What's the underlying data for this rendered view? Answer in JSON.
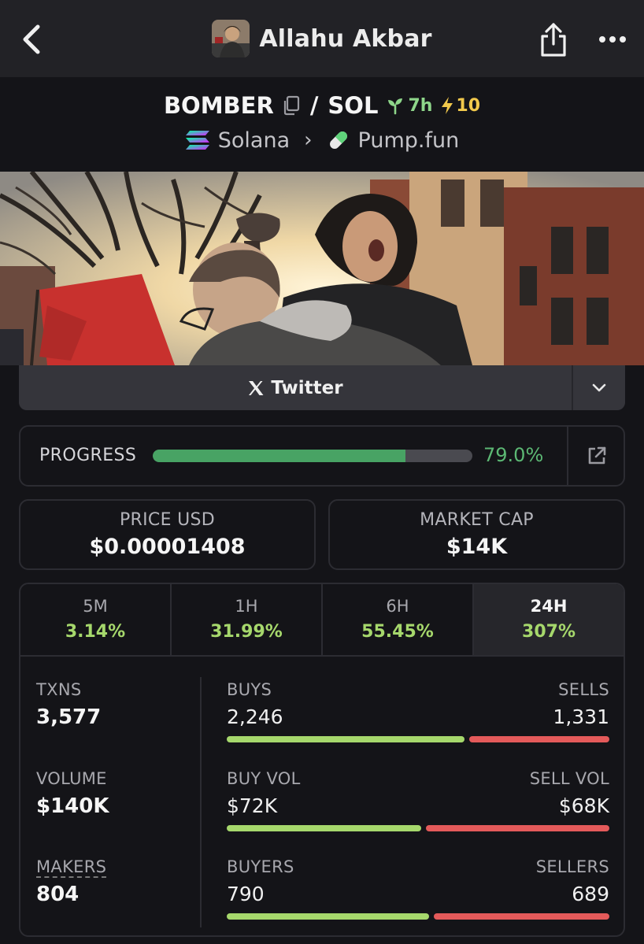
{
  "header": {
    "title": "Allahu Akbar"
  },
  "pair": {
    "base": "BOMBER",
    "separator": "/",
    "quote": "SOL",
    "age": "7h",
    "boosts": "10",
    "chain": "Solana",
    "dex": "Pump.fun"
  },
  "socials": {
    "twitter_label": "Twitter"
  },
  "progress": {
    "label": "PROGRESS",
    "value_text": "79.0%",
    "fraction": 0.79
  },
  "price": {
    "label": "PRICE USD",
    "value": "$0.00001408"
  },
  "market_cap": {
    "label": "MARKET CAP",
    "value": "$14K"
  },
  "timeframes": [
    {
      "label": "5M",
      "change": "3.14%"
    },
    {
      "label": "1H",
      "change": "31.99%"
    },
    {
      "label": "6H",
      "change": "55.45%"
    },
    {
      "label": "24H",
      "change": "307%",
      "active": true
    }
  ],
  "stats": {
    "txns": {
      "label": "TXNS",
      "value": "3,577"
    },
    "volume": {
      "label": "VOLUME",
      "value": "$140K"
    },
    "makers": {
      "label": "MAKERS",
      "value": "804"
    },
    "buys_sells": {
      "left_label": "BUYS",
      "right_label": "SELLS",
      "left_value": "2,246",
      "right_value": "1,331",
      "buy_share": 0.628
    },
    "buy_sell_vol": {
      "left_label": "BUY VOL",
      "right_label": "SELL VOL",
      "left_value": "$72K",
      "right_value": "$68K",
      "buy_share": 0.514
    },
    "buyers_sellers": {
      "left_label": "BUYERS",
      "right_label": "SELLERS",
      "left_value": "790",
      "right_value": "689",
      "buy_share": 0.534
    }
  },
  "colors": {
    "positive": "#a6d86c",
    "buy_bar": "#a6d86c",
    "sell_bar": "#e45a5a",
    "progress": "#48a364"
  },
  "icons": {
    "back": "chevron-left-icon",
    "share": "share-icon",
    "more": "more-horizontal-icon",
    "copy": "copy-icon",
    "age": "sprout-icon",
    "boost": "lightning-icon",
    "chain": "solana-icon",
    "dex": "pill-icon",
    "twitter": "x-logo-icon",
    "dropdown": "chevron-down-icon",
    "external": "external-link-icon"
  }
}
